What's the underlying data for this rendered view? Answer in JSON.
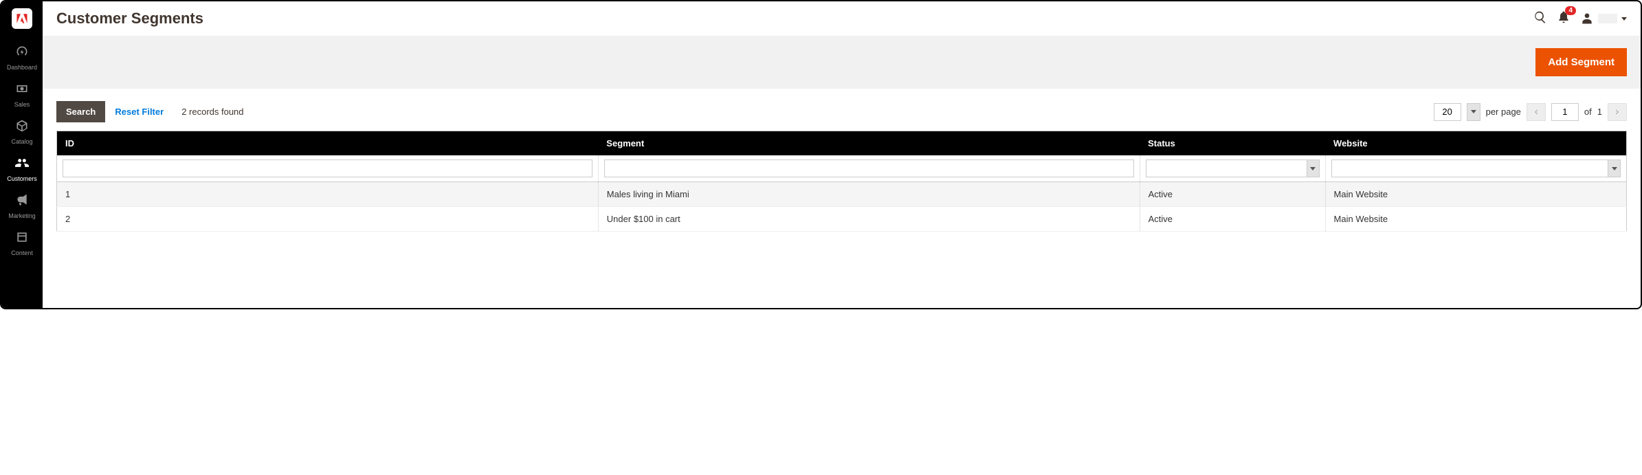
{
  "sidebar": {
    "items": [
      {
        "label": "Dashboard",
        "active": false
      },
      {
        "label": "Sales",
        "active": false
      },
      {
        "label": "Catalog",
        "active": false
      },
      {
        "label": "Customers",
        "active": true
      },
      {
        "label": "Marketing",
        "active": false
      },
      {
        "label": "Content",
        "active": false
      }
    ]
  },
  "header": {
    "title": "Customer Segments",
    "notification_count": "4"
  },
  "action_bar": {
    "add_label": "Add Segment"
  },
  "toolbar": {
    "search_label": "Search",
    "reset_label": "Reset Filter",
    "records_found": "2 records found",
    "per_page_value": "20",
    "per_page_label": "per page",
    "current_page": "1",
    "of_label": "of",
    "total_pages": "1"
  },
  "table": {
    "columns": [
      "ID",
      "Segment",
      "Status",
      "Website"
    ],
    "rows": [
      {
        "id": "1",
        "segment": "Males living in Miami",
        "status": "Active",
        "website": "Main Website"
      },
      {
        "id": "2",
        "segment": "Under $100 in cart",
        "status": "Active",
        "website": "Main Website"
      }
    ]
  }
}
